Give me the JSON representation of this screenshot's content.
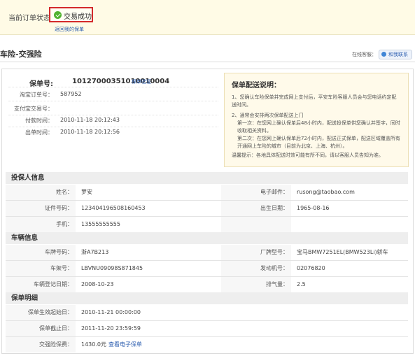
{
  "status": {
    "label": "当前订单状态：",
    "value": "交易成功",
    "back_link": "返回我的保单"
  },
  "product": {
    "title": "车险-交强险",
    "service_label": "在线客服：",
    "service_button": "和我联系"
  },
  "policy": {
    "label": "保单号:",
    "value": "10127000351010010004",
    "verify_link": "保单验证",
    "meta": [
      {
        "label": "淘宝订单号：",
        "value": "587952"
      },
      {
        "label": "支付宝交易号：",
        "value": ""
      },
      {
        "label": "付款时间：",
        "value": "2010-11-18 20:12:43"
      },
      {
        "label": "出单时间：",
        "value": "2010-11-18 20:12:56"
      }
    ]
  },
  "notice": {
    "title": "保单配送说明：",
    "items": [
      "1、您确认车险保单并完成网上支付后，平安车险客服人员会与您电话约定配送时间。",
      "2、通常会安排两次保单配送上门",
      "第一次：在您网上确认保单后48小时内，配送投保单供您确认并签字，同时收取相关资料。",
      "第二次：在您网上确认保单后72小时内，配送正式保单，配送区域覆盖所有开通网上车险的城市（目前为北京、上海、杭州）。",
      "温馨提示：各地具体配送时效可能有所不同，请以客服人员告知为准。"
    ]
  },
  "insured": {
    "title": "投保人信息",
    "rows": [
      {
        "l1": "姓名：",
        "v1": "罗安",
        "l2": "电子邮件：",
        "v2": "rusong@taobao.com"
      },
      {
        "l1": "证件号码：",
        "v1": "123404196508160453",
        "l2": "出生日期：",
        "v2": "1965-08-16"
      },
      {
        "l1": "手机：",
        "v1": "13555555555",
        "l2": "",
        "v2": ""
      }
    ]
  },
  "vehicle": {
    "title": "车辆信息",
    "rows": [
      {
        "l1": "车牌号码：",
        "v1": "浙A7B213",
        "l2": "厂牌型号：",
        "v2": "宝马BMW7251EL(BMW523Li)轿车"
      },
      {
        "l1": "车架号：",
        "v1": "LBVNU09098S871845",
        "l2": "发动机号：",
        "v2": "02076820"
      },
      {
        "l1": "车辆登记日期：",
        "v1": "2008-10-23",
        "l2": "排气量：",
        "v2": "2.5"
      }
    ]
  },
  "detail": {
    "title": "保单明细",
    "rows": [
      {
        "label": "保单生效起始日：",
        "value": "2010-11-21 00:00:00"
      },
      {
        "label": "保单截止日：",
        "value": "2011-11-20 23:59:59"
      },
      {
        "label": "交强险保费：",
        "value": "1430.0元",
        "link": "查看电子保单"
      }
    ]
  }
}
